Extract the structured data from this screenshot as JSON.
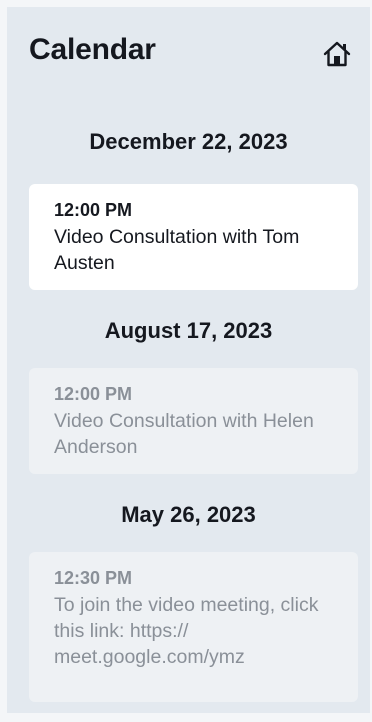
{
  "header": {
    "title": "Calendar",
    "home_icon": "home-icon"
  },
  "appointments": [
    {
      "date": "December 22, 2023",
      "time": "12:00 PM",
      "description": "Video Consultation with Tom Austen",
      "state": "upcoming"
    },
    {
      "date": "August 17, 2023",
      "time": "12:00 PM",
      "description": "Video Consultation with Helen Anderson",
      "state": "past"
    },
    {
      "date": "May 26, 2023",
      "time": "12:30 PM",
      "description": "To join the video meeting, click this link: https:// meet.google.com/ymz",
      "state": "past"
    }
  ],
  "colors": {
    "background": "#e3e9ef",
    "card_active": "#ffffff",
    "card_past": "#eef1f4",
    "text_primary": "#15181f",
    "text_muted": "#8a9098"
  }
}
